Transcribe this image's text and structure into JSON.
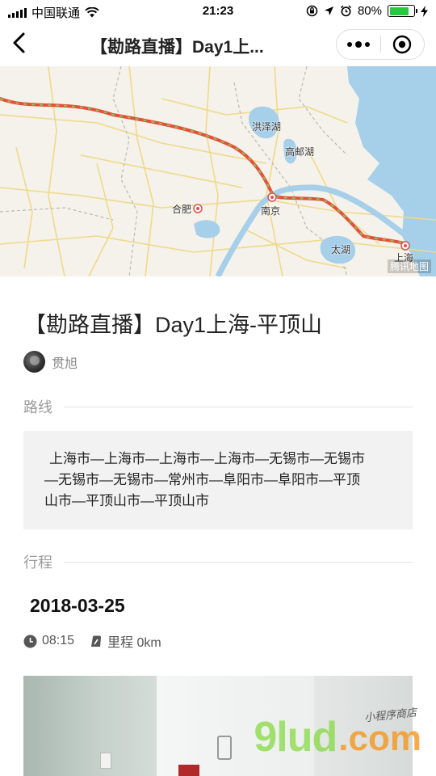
{
  "status_bar": {
    "carrier": "中国联通",
    "time": "21:23",
    "battery_percent": "80%",
    "battery_level": 0.8,
    "icons": [
      "signal-icon",
      "wifi-icon",
      "rotation-lock-icon",
      "location-icon",
      "alarm-icon",
      "battery-icon",
      "charging-icon"
    ]
  },
  "nav": {
    "title": "【勘路直播】Day1上...",
    "back_icon": "chevron-left-icon",
    "more_icon": "more-dots-icon",
    "close_icon": "target-close-icon"
  },
  "map": {
    "labels": {
      "hefei": "合肥",
      "nanjing": "南京",
      "hongze_lake": "洪泽湖",
      "gaoyou_lake": "高邮湖",
      "tai_lake": "太湖",
      "shanghai": "上海"
    },
    "brand": "腾讯地图",
    "route_color": "#e74c3c",
    "route_dash_color": "#8bc34a",
    "water_color": "#a6cfea",
    "land_color": "#f4f2ea"
  },
  "article": {
    "title": "【勘路直播】Day1上海-平顶山",
    "author": "贯旭"
  },
  "route_section": {
    "label": "路线",
    "lines": [
      "上海市—上海市—上海市—上海市—无锡市—无锡市",
      "—无锡市—无锡市—常州市—阜阳市—阜阳市—平顶",
      "山市—平顶山市—平顶山市"
    ]
  },
  "itinerary_section": {
    "label": "行程",
    "date": "2018-03-25",
    "time": "08:15",
    "mileage": "里程 0km"
  },
  "watermark": {
    "main": "9lud",
    "dot": ".com",
    "sub": "小程序商店"
  }
}
